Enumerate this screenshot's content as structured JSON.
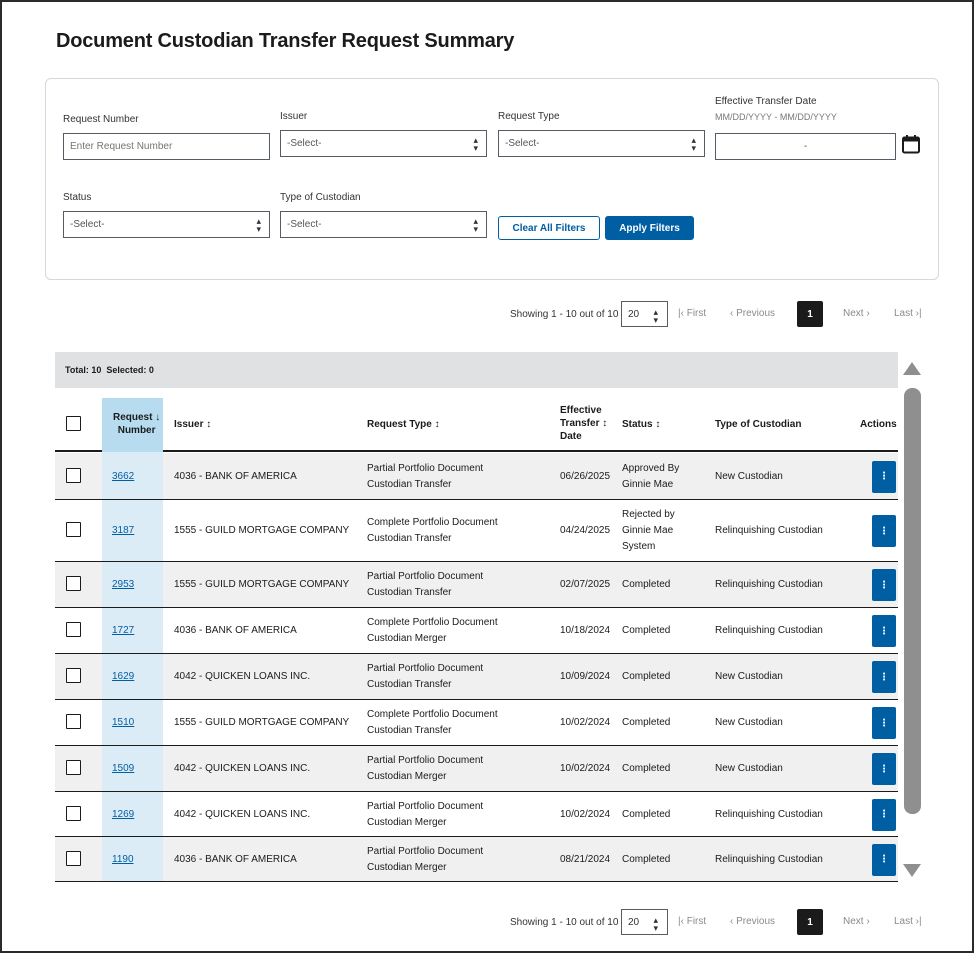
{
  "page": {
    "title": "Document Custodian Transfer Request Summary"
  },
  "filters": {
    "request_number": {
      "label": "Request Number",
      "placeholder": "Enter Request Number"
    },
    "issuer": {
      "label": "Issuer",
      "value": "-Select-"
    },
    "request_type": {
      "label": "Request Type",
      "value": "-Select-"
    },
    "effective_date": {
      "label": "Effective Transfer Date",
      "hint": "MM/DD/YYYY - MM/DD/YYYY",
      "value": "-"
    },
    "status": {
      "label": "Status",
      "value": "-Select-"
    },
    "custodian_type": {
      "label": "Type of Custodian",
      "value": "-Select-"
    },
    "clear_label": "Clear All Filters",
    "apply_label": "Apply Filters"
  },
  "pagination": {
    "showing": "Showing 1 - 10 out of 10",
    "page_size": "20",
    "first": "|‹ First",
    "previous": "‹ Previous",
    "current": "1",
    "next": "Next ›",
    "last": "Last ›|"
  },
  "summary": {
    "total": "Total: 10",
    "selected": "Selected: 0"
  },
  "table": {
    "headers": {
      "request_number": [
        "Request",
        "Number"
      ],
      "issuer": "Issuer ↕",
      "request_type": "Request Type ↕",
      "effective_date": [
        "Effective",
        "Transfer ↕",
        "Date"
      ],
      "status": "Status ↕",
      "custodian_type": "Type of Custodian",
      "actions": "Actions"
    },
    "rows": [
      {
        "request_number": "3662",
        "issuer": "4036 - BANK OF AMERICA",
        "request_type": [
          "Partial Portfolio Document",
          "Custodian Transfer"
        ],
        "date": "06/26/2025",
        "status": [
          "Approved By",
          "Ginnie Mae"
        ],
        "custodian": "New Custodian"
      },
      {
        "request_number": "3187",
        "issuer": "1555 - GUILD MORTGAGE COMPANY",
        "request_type": [
          "Complete Portfolio Document",
          "Custodian Transfer"
        ],
        "date": "04/24/2025",
        "status": [
          "Rejected by",
          "Ginnie Mae",
          "System"
        ],
        "custodian": "Relinquishing Custodian"
      },
      {
        "request_number": "2953",
        "issuer": "1555 - GUILD MORTGAGE COMPANY",
        "request_type": [
          "Partial Portfolio Document",
          "Custodian Transfer"
        ],
        "date": "02/07/2025",
        "status": [
          "Completed"
        ],
        "custodian": "Relinquishing Custodian"
      },
      {
        "request_number": "1727",
        "issuer": "4036 - BANK OF AMERICA",
        "request_type": [
          "Complete Portfolio Document",
          "Custodian Merger"
        ],
        "date": "10/18/2024",
        "status": [
          "Completed"
        ],
        "custodian": "Relinquishing Custodian"
      },
      {
        "request_number": "1629",
        "issuer": "4042 - QUICKEN LOANS INC.",
        "request_type": [
          "Partial Portfolio Document",
          "Custodian Transfer"
        ],
        "date": "10/09/2024",
        "status": [
          "Completed"
        ],
        "custodian": "New Custodian"
      },
      {
        "request_number": "1510",
        "issuer": "1555 - GUILD MORTGAGE COMPANY",
        "request_type": [
          "Complete Portfolio Document",
          "Custodian Transfer"
        ],
        "date": "10/02/2024",
        "status": [
          "Completed"
        ],
        "custodian": "New Custodian"
      },
      {
        "request_number": "1509",
        "issuer": "4042 - QUICKEN LOANS INC.",
        "request_type": [
          "Partial Portfolio Document",
          "Custodian Merger"
        ],
        "date": "10/02/2024",
        "status": [
          "Completed"
        ],
        "custodian": "New Custodian"
      },
      {
        "request_number": "1269",
        "issuer": "4042 - QUICKEN LOANS INC.",
        "request_type": [
          "Partial Portfolio Document",
          "Custodian Merger"
        ],
        "date": "10/02/2024",
        "status": [
          "Completed"
        ],
        "custodian": "Relinquishing Custodian"
      },
      {
        "request_number": "1190",
        "issuer": "4036 - BANK OF AMERICA",
        "request_type": [
          "Partial Portfolio Document",
          "Custodian Merger"
        ],
        "date": "08/21/2024",
        "status": [
          "Completed"
        ],
        "custodian": "Relinquishing Custodian"
      }
    ]
  },
  "colors": {
    "primary": "#005ea2",
    "sorted_column": "#b7dcf0",
    "header_bar": "#dfe1e2"
  },
  "icons": {
    "calendar": "calendar-icon",
    "actions": "kebab-icon",
    "sort": "sort-arrow-icon"
  }
}
